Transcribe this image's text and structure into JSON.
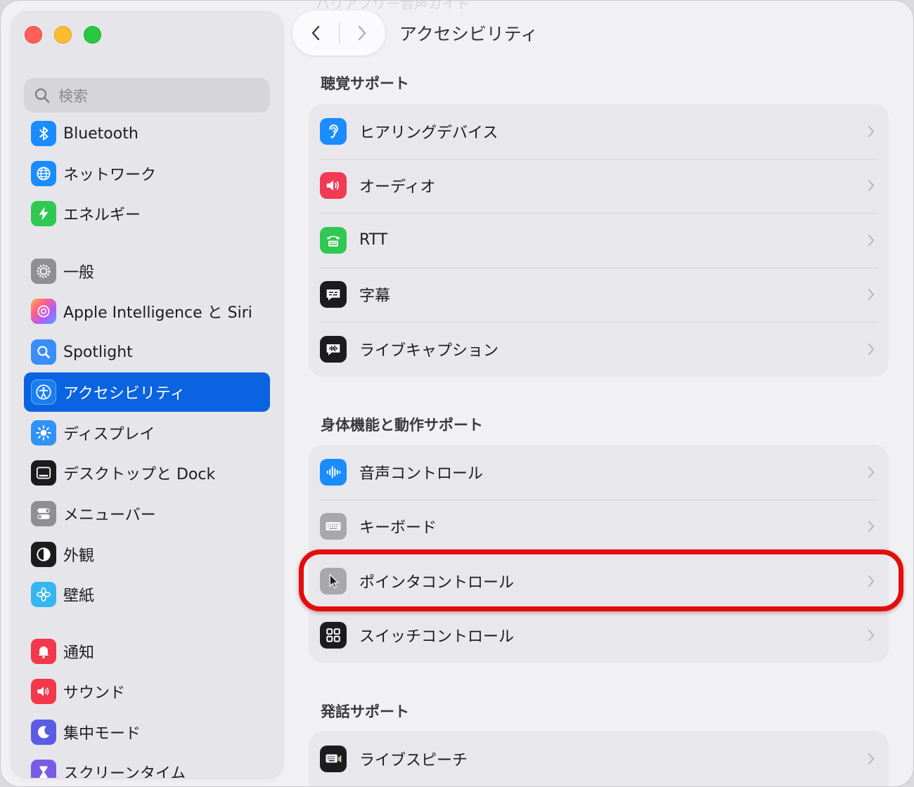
{
  "window": {
    "title": "アクセシビリティ",
    "ghost_title": "バリアフリー音声ガイド"
  },
  "search": {
    "placeholder": "検索"
  },
  "sidebar": {
    "items": [
      {
        "label": "Bluetooth",
        "icon": "bluetooth-icon",
        "color": "#1a8cff"
      },
      {
        "label": "ネットワーク",
        "icon": "globe-icon",
        "color": "#1a8cff"
      },
      {
        "label": "エネルギー",
        "icon": "bolt-icon",
        "color": "#30c752"
      },
      {
        "label": "一般",
        "icon": "gear-icon",
        "color": "#8e8e93"
      },
      {
        "label": "Apple Intelligence と Siri",
        "icon": "apple-intelligence-icon",
        "color": "#ff8a3d"
      },
      {
        "label": "Spotlight",
        "icon": "magnifier-icon",
        "color": "#3a8dfa"
      },
      {
        "label": "アクセシビリティ",
        "icon": "accessibility-icon",
        "color": "#1a7df2",
        "selected": true
      },
      {
        "label": "ディスプレイ",
        "icon": "sun-icon",
        "color": "#2f93f6"
      },
      {
        "label": "デスクトップと Dock",
        "icon": "dock-icon",
        "color": "#1c1c1e"
      },
      {
        "label": "メニューバー",
        "icon": "toggle-icon",
        "color": "#8e8e93"
      },
      {
        "label": "外観",
        "icon": "appearance-icon",
        "color": "#1c1c1e"
      },
      {
        "label": "壁紙",
        "icon": "flower-icon",
        "color": "#36b6ef"
      },
      {
        "label": "通知",
        "icon": "bell-icon",
        "color": "#f2384a"
      },
      {
        "label": "サウンド",
        "icon": "speaker-icon",
        "color": "#f2384a"
      },
      {
        "label": "集中モード",
        "icon": "moon-icon",
        "color": "#5b5be6"
      },
      {
        "label": "スクリーンタイム",
        "icon": "hourglass-icon",
        "color": "#7a5be6"
      }
    ]
  },
  "sections": [
    {
      "title": "聴覚サポート",
      "rows": [
        {
          "label": "ヒアリングデバイス",
          "icon": "ear-icon",
          "color": "#1a8cff"
        },
        {
          "label": "オーディオ",
          "icon": "speaker-icon",
          "color": "#f23a55"
        },
        {
          "label": "RTT",
          "icon": "tty-icon",
          "color": "#30c752"
        },
        {
          "label": "字幕",
          "icon": "captions-icon",
          "color": "#1c1c1e"
        },
        {
          "label": "ライブキャプション",
          "icon": "live-captions-icon",
          "color": "#1c1c1e"
        }
      ]
    },
    {
      "title": "身体機能と動作サポート",
      "rows": [
        {
          "label": "音声コントロール",
          "icon": "waveform-icon",
          "color": "#1a8cff"
        },
        {
          "label": "キーボード",
          "icon": "keyboard-icon",
          "color": "#a7a7ac"
        },
        {
          "label": "ポインタコントロール",
          "icon": "pointer-icon",
          "color": "#a7a7ac",
          "highlighted": true
        },
        {
          "label": "スイッチコントロール",
          "icon": "switch-grid-icon",
          "color": "#1c1c1e"
        }
      ]
    },
    {
      "title": "発話サポート",
      "rows": [
        {
          "label": "ライブスピーチ",
          "icon": "live-speech-icon",
          "color": "#1c1c1e"
        }
      ]
    }
  ],
  "accent": "#0a63e0",
  "highlight_color": "#e30d0d"
}
